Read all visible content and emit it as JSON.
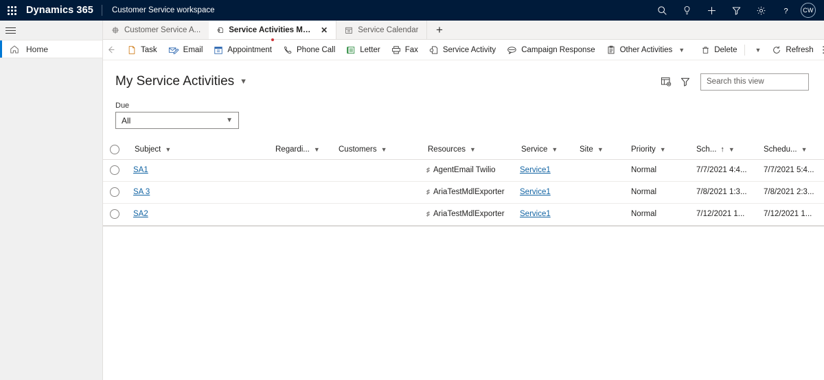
{
  "topbar": {
    "waffle_label": "app-launcher",
    "brand": "Dynamics 365",
    "app_name": "Customer Service workspace",
    "icons": [
      "search-icon",
      "lightbulb-icon",
      "plus-icon",
      "filter-icon",
      "gear-icon",
      "help-icon"
    ],
    "avatar_initials": "CW"
  },
  "rail": {
    "menu_label": "site-map-menu",
    "items": [
      {
        "label": "Home",
        "icon": "home-icon",
        "selected": true
      }
    ]
  },
  "tabs": [
    {
      "label": "Customer Service A...",
      "icon": "dashboard-icon",
      "active": false,
      "closable": false
    },
    {
      "label": "Service Activities My Ser...",
      "icon": "service-activity-icon",
      "active": true,
      "closable": true,
      "dirty_dot": true
    },
    {
      "label": "Service Calendar",
      "icon": "calendar-icon",
      "active": false,
      "closable": false
    }
  ],
  "tab_add_label": "+",
  "commandbar": {
    "back_label": "back",
    "commands": [
      {
        "label": "Task",
        "icon": "task-icon",
        "caret": false
      },
      {
        "label": "Email",
        "icon": "email-icon",
        "caret": false
      },
      {
        "label": "Appointment",
        "icon": "appointment-icon",
        "caret": false
      },
      {
        "label": "Phone Call",
        "icon": "phone-icon",
        "caret": false
      },
      {
        "label": "Letter",
        "icon": "letter-icon",
        "caret": false
      },
      {
        "label": "Fax",
        "icon": "fax-icon",
        "caret": false
      },
      {
        "label": "Service Activity",
        "icon": "service-activity-icon",
        "caret": false
      },
      {
        "label": "Campaign Response",
        "icon": "campaign-response-icon",
        "caret": false
      },
      {
        "label": "Other Activities",
        "icon": "other-activities-icon",
        "caret": true
      },
      {
        "label": "Delete",
        "icon": "trash-icon",
        "caret": true,
        "separator_before": true
      },
      {
        "label": "Refresh",
        "icon": "refresh-icon",
        "caret": false
      }
    ],
    "overflow_label": "⋮"
  },
  "view": {
    "title": "My Service Activities",
    "edit_columns_icon": "edit-columns-icon",
    "edit_filters_icon": "edit-filters-icon"
  },
  "search": {
    "placeholder": "Search this view",
    "value": "",
    "icon": "search-icon"
  },
  "due_filter": {
    "label": "Due",
    "value": "All",
    "options": [
      "All"
    ]
  },
  "grid": {
    "columns": [
      {
        "key": "select",
        "label": "",
        "caret": false,
        "sorted": false
      },
      {
        "key": "subject",
        "label": "Subject",
        "caret": true,
        "sorted": false
      },
      {
        "key": "regarding",
        "label": "Regardi...",
        "caret": true,
        "sorted": false
      },
      {
        "key": "customers",
        "label": "Customers",
        "caret": true,
        "sorted": false
      },
      {
        "key": "resources",
        "label": "Resources",
        "caret": true,
        "sorted": false
      },
      {
        "key": "service",
        "label": "Service",
        "caret": true,
        "sorted": false
      },
      {
        "key": "site",
        "label": "Site",
        "caret": true,
        "sorted": false
      },
      {
        "key": "priority",
        "label": "Priority",
        "caret": true,
        "sorted": false
      },
      {
        "key": "scheduled_start",
        "label": "Sch...",
        "caret": true,
        "sorted": true,
        "sort_dir": "asc"
      },
      {
        "key": "scheduled_end",
        "label": "Schedu...",
        "caret": true,
        "sorted": false
      }
    ],
    "rows": [
      {
        "subject": "SA1",
        "regarding": "",
        "customers": "",
        "resources": "AgentEmail Twilio",
        "service": "Service1",
        "site": "",
        "priority": "Normal",
        "scheduled_start": "7/7/2021 4:4...",
        "scheduled_end": "7/7/2021 5:4..."
      },
      {
        "subject": "SA 3",
        "regarding": "",
        "customers": "",
        "resources": "AriaTestMdlExporter",
        "service": "Service1",
        "site": "",
        "priority": "Normal",
        "scheduled_start": "7/8/2021 1:3...",
        "scheduled_end": "7/8/2021 2:3..."
      },
      {
        "subject": "SA2",
        "regarding": "",
        "customers": "",
        "resources": "AriaTestMdlExporter",
        "service": "Service1",
        "site": "",
        "priority": "Normal",
        "scheduled_start": "7/12/2021 1...",
        "scheduled_end": "7/12/2021 1..."
      }
    ]
  },
  "colors": {
    "navbar": "#001b3a",
    "accent": "#0078d4",
    "link": "#1264a3",
    "dirty_dot": "#d13438",
    "rail_bg": "#f0f0f0",
    "tabstrip_bg": "#f3f2f1"
  }
}
